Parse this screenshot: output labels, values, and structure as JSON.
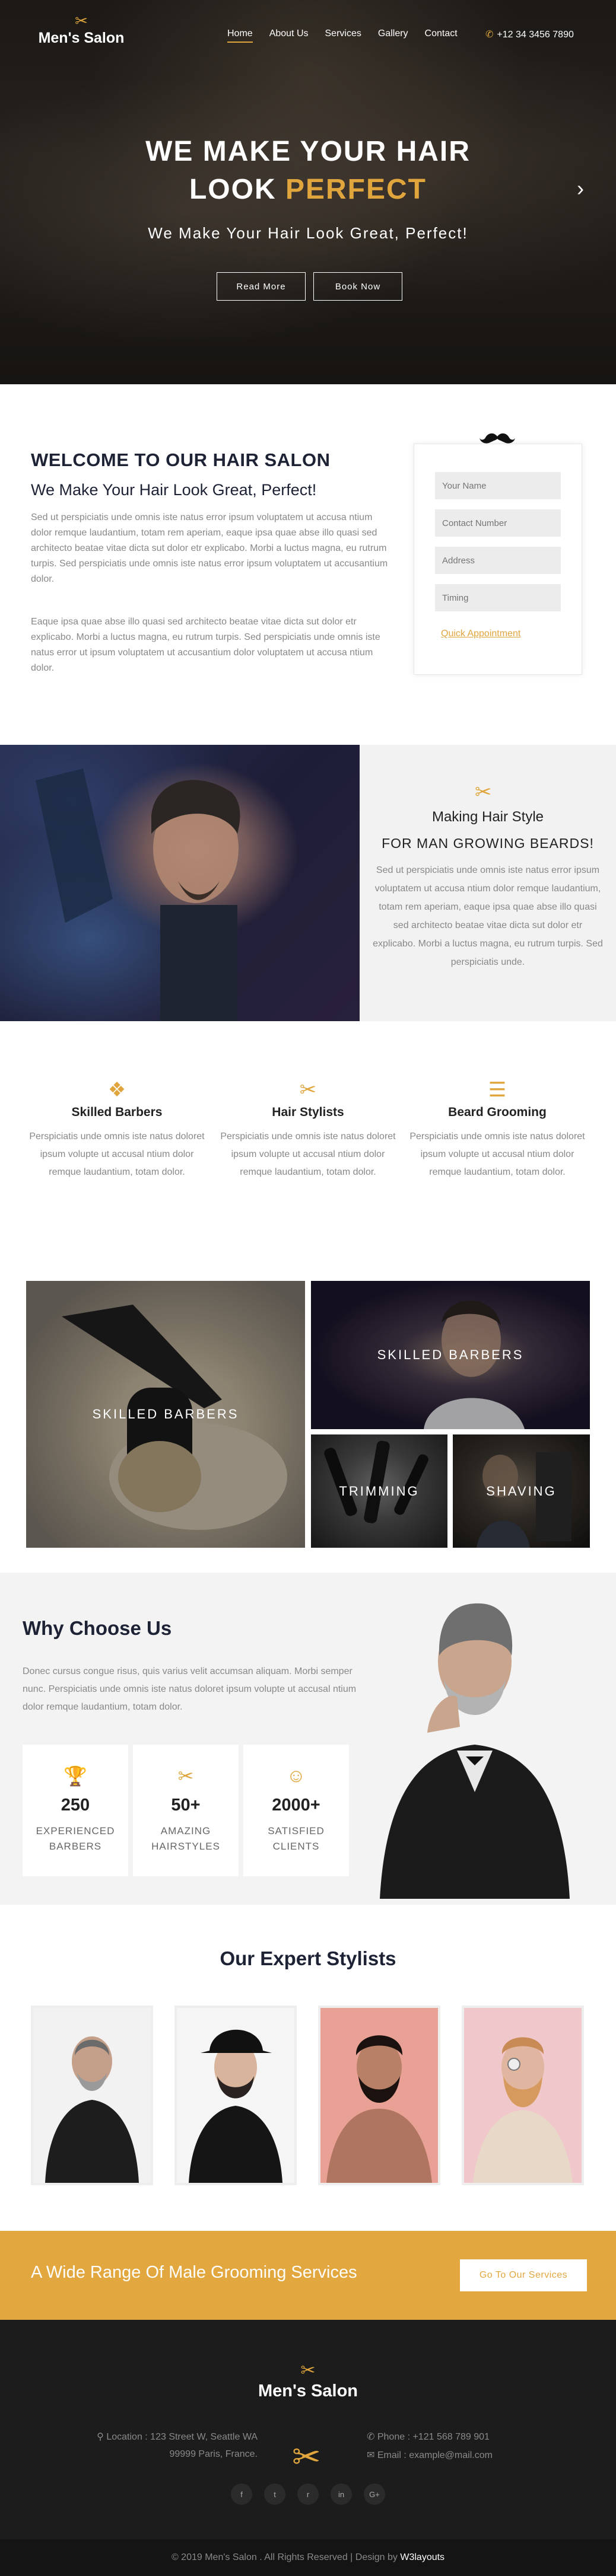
{
  "nav": {
    "logo": "Men's Salon",
    "items": [
      "Home",
      "About Us",
      "Services",
      "Gallery",
      "Contact"
    ],
    "phone": "+12 34 3456 7890"
  },
  "hero": {
    "line1": "WE MAKE YOUR HAIR",
    "line2a": "LOOK",
    "line2b": "PERFECT",
    "subtitle": "We Make Your Hair Look Great, Perfect!",
    "btn_read": "Read More",
    "btn_book": "Book Now"
  },
  "welcome": {
    "title": "WELCOME TO OUR HAIR SALON",
    "subtitle": "We Make Your Hair Look Great, Perfect!",
    "para1": "Sed ut perspiciatis unde omnis iste natus error ipsum voluptatem ut accusa ntium dolor remque laudantium, totam rem aperiam, eaque ipsa quae abse illo quasi sed architecto beatae vitae dicta sut dolor etr explicabo. Morbi a luctus magna, eu rutrum turpis. Sed perspiciatis unde omnis iste natus error ipsum voluptatem ut accusantium dolor.",
    "para2": "Eaque ipsa quae abse illo quasi sed architecto beatae vitae dicta sut dolor etr explicabo. Morbi a luctus magna, eu rutrum turpis. Sed perspiciatis unde omnis iste natus error ut ipsum voluptatem ut accusantium dolor voluptatem ut accusa ntium dolor.",
    "form": {
      "name": "Your Name",
      "contact": "Contact Number",
      "address": "Address",
      "timing": "Timing",
      "link": "Quick Appointment"
    }
  },
  "style": {
    "title": "Making Hair Style",
    "subtitle": "FOR MAN GROWING BEARDS!",
    "para": "Sed ut perspiciatis unde omnis iste natus error ipsum voluptatem ut accusa ntium dolor remque laudantium, totam rem aperiam, eaque ipsa quae abse illo quasi sed architecto beatae vitae dicta sut dolor etr explicabo. Morbi a luctus magna, eu rutrum turpis. Sed perspiciatis unde."
  },
  "features": [
    {
      "icon": "puzzle-icon",
      "title": "Skilled Barbers",
      "text": "Perspiciatis unde omnis iste natus doloret ipsum volupte ut accusal ntium dolor remque laudantium, totam dolor."
    },
    {
      "icon": "scissors-icon",
      "title": "Hair Stylists",
      "text": "Perspiciatis unde omnis iste natus doloret ipsum volupte ut accusal ntium dolor remque laudantium, totam dolor."
    },
    {
      "icon": "sliders-icon",
      "title": "Beard Grooming",
      "text": "Perspiciatis unde omnis iste natus doloret ipsum volupte ut accusal ntium dolor remque laudantium, totam dolor."
    }
  ],
  "gallery": [
    "SKILLED BARBERS",
    "SKILLED BARBERS",
    "TRIMMING",
    "SHAVING"
  ],
  "why": {
    "title": "Why Choose Us",
    "para": "Donec cursus congue risus, quis varius velit accumsan aliquam. Morbi semper nunc. Perspiciatis unde omnis iste natus doloret ipsum volupte ut accusal ntium dolor remque laudantium, totam dolor.",
    "stats": [
      {
        "icon": "trophy-icon",
        "num": "250",
        "label1": "EXPERIENCED",
        "label2": "BARBERS"
      },
      {
        "icon": "scissors-icon",
        "num": "50+",
        "label1": "AMAZING",
        "label2": "HAIRSTYLES"
      },
      {
        "icon": "smile-icon",
        "num": "2000+",
        "label1": "SATISFIED",
        "label2": "CLIENTS"
      }
    ]
  },
  "stylists": {
    "title": "Our Expert Stylists"
  },
  "banner": {
    "text": "A Wide Range Of Male Grooming Services",
    "button": "Go To Our Services"
  },
  "footer": {
    "logo": "Men's Salon",
    "location1": "Location : 123 Street W, Seattle WA",
    "location2": "99999 Paris, France.",
    "phone": "Phone : +121 568 789 901",
    "email": "Email : example@mail.com",
    "social": [
      "f",
      "t",
      "r",
      "in",
      "G+"
    ],
    "copyright": "© 2019 Men's Salon . All Rights Reserved | Design by",
    "designer": "W3layouts"
  },
  "colors": {
    "accent": "#e0a63d",
    "dark": "#1e2235",
    "footer": "#1c1c1c"
  }
}
